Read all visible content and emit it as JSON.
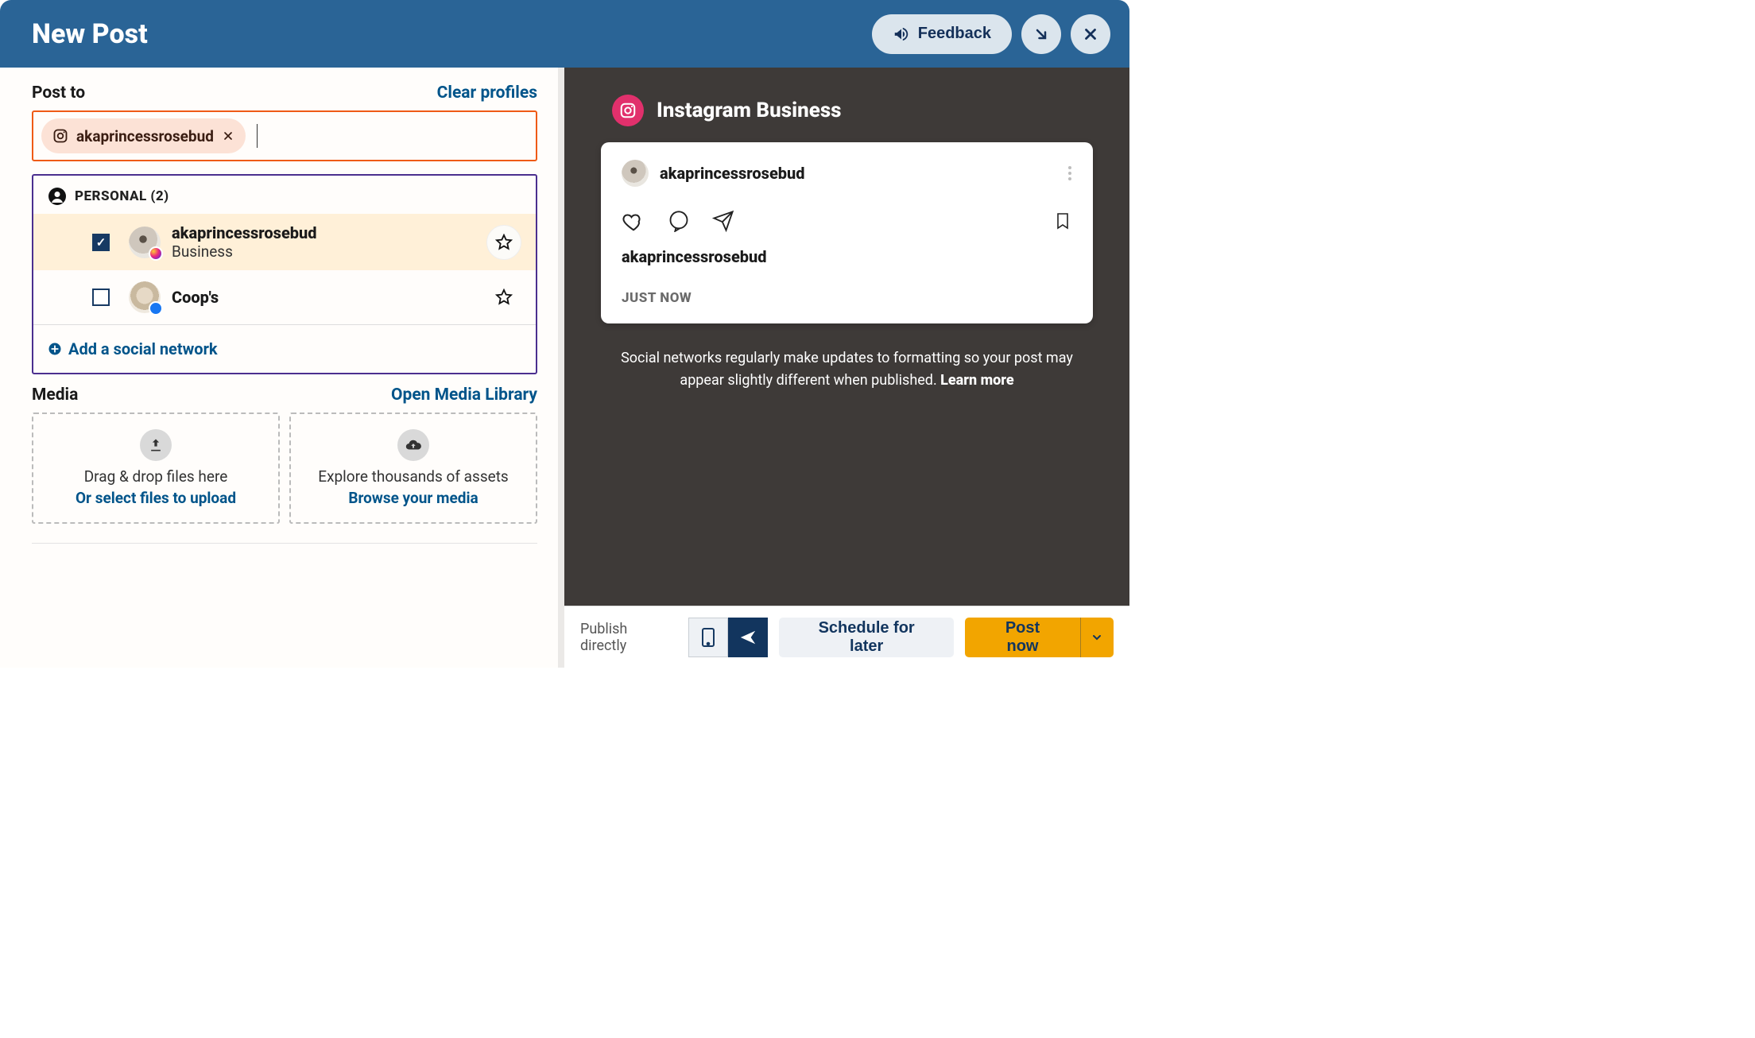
{
  "header": {
    "title": "New Post",
    "feedback": "Feedback"
  },
  "postTo": {
    "label": "Post to",
    "clear": "Clear profiles",
    "chip": {
      "name": "akaprincessrosebud"
    }
  },
  "profiles": {
    "groupLabel": "PERSONAL (2)",
    "items": [
      {
        "name": "akaprincessrosebud",
        "sub": "Business",
        "checked": true,
        "network": "instagram"
      },
      {
        "name": "Coop's",
        "sub": "",
        "checked": false,
        "network": "facebook"
      }
    ],
    "addLabel": "Add a social network"
  },
  "media": {
    "label": "Media",
    "open": "Open Media Library",
    "zone1": {
      "line1": "Drag & drop files here",
      "line2": "Or select files to upload"
    },
    "zone2": {
      "line1": "Explore thousands of assets",
      "line2": "Browse your media"
    }
  },
  "preview": {
    "title": "Instagram Business",
    "user": "akaprincessrosebud",
    "caption": "akaprincessrosebud",
    "time": "JUST NOW",
    "note": "Social networks regularly make updates to formatting so your post may appear slightly different when published. ",
    "learn": "Learn more"
  },
  "footer": {
    "publish": "Publish directly",
    "schedule": "Schedule for later",
    "postNow": "Post now"
  }
}
